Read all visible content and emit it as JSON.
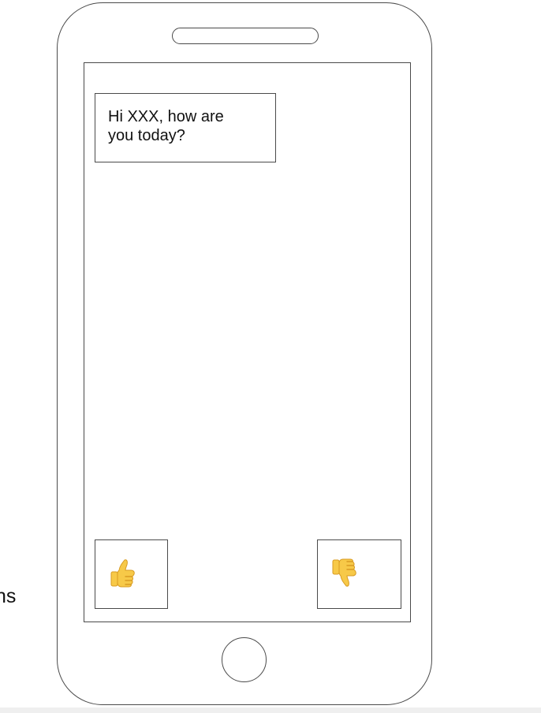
{
  "side_text": {
    "upper": ":",
    "lower": "ns"
  },
  "chat": {
    "message": "Hi XXX, how are\nyou today?"
  },
  "actions": {
    "like_icon": "thumbs-up-icon",
    "dislike_icon": "thumbs-down-icon"
  },
  "colors": {
    "outline": "#4a4a4a",
    "text": "#111111",
    "emoji_fill": "#f7c948",
    "emoji_shadow": "#d89b22"
  }
}
